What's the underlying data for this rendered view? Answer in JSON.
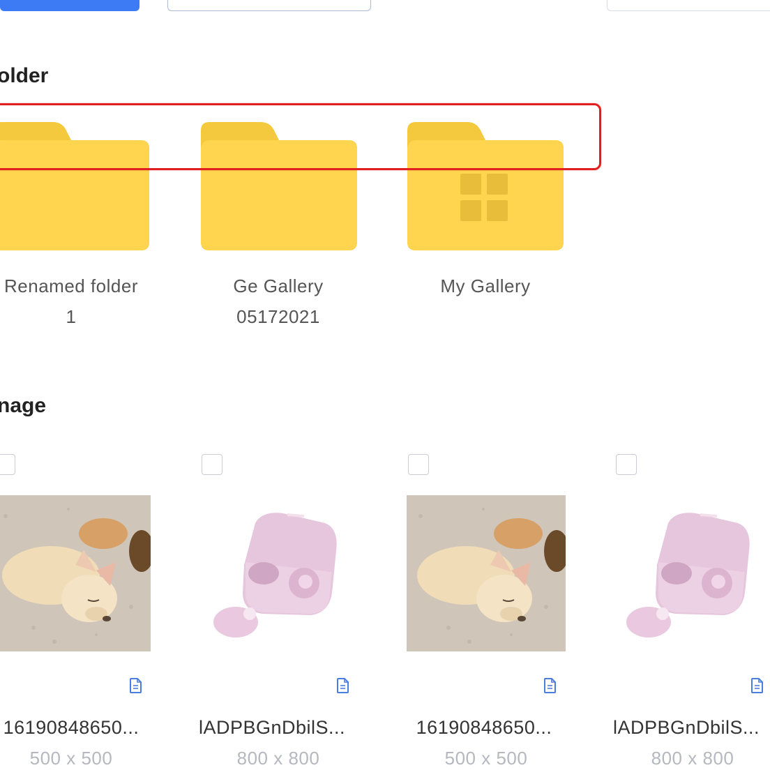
{
  "sections": {
    "folder_title": "older",
    "image_title": "nage"
  },
  "folders": [
    {
      "name_line1": "Renamed folder",
      "name_line2": "1"
    },
    {
      "name_line1": "Ge Gallery",
      "name_line2": "05172021"
    },
    {
      "name_line1": "My Gallery",
      "name_line2": ""
    }
  ],
  "images": [
    {
      "name": "16190848650...",
      "size": "500 x 500",
      "kind": "puppy"
    },
    {
      "name": "lADPBGnDbilS...",
      "size": "800 x 800",
      "kind": "earbuds"
    },
    {
      "name": "16190848650...",
      "size": "500 x 500",
      "kind": "puppy"
    },
    {
      "name": "lADPBGnDbilS...",
      "size": "800 x 800",
      "kind": "earbuds"
    }
  ],
  "colors": {
    "folder": "#ffd54f",
    "folder_tab": "#f5c93e",
    "highlight": "#e02020",
    "primary": "#3d7bf5",
    "icon_blue": "#4a7de0"
  },
  "icons": {
    "document": "document-icon",
    "folder": "folder-icon",
    "gallery_grid": "grid-icon"
  }
}
